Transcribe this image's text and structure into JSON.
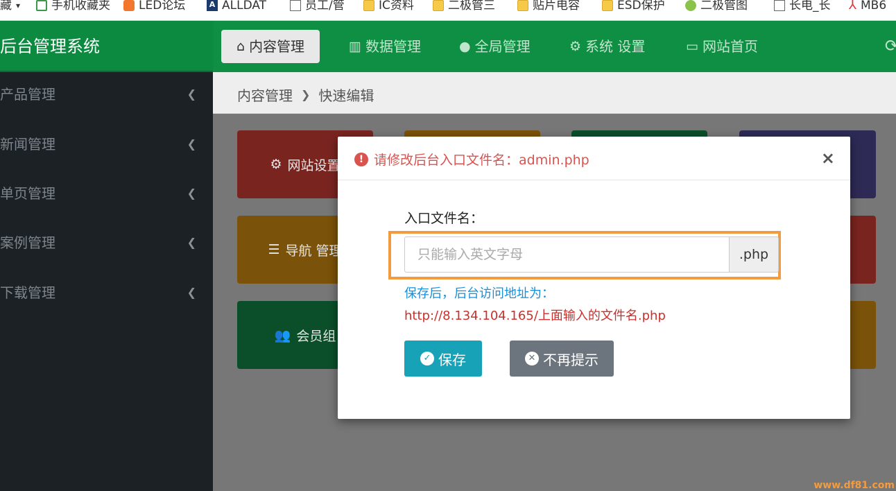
{
  "bookmarks": [
    {
      "label": "藏",
      "icon": "chevron-down-icon"
    },
    {
      "label": "手机收藏夹",
      "icon": "phone-icon"
    },
    {
      "label": "LED论坛",
      "icon": "plug-icon"
    },
    {
      "label": "ALLDAT",
      "icon": "pdf-a-icon"
    },
    {
      "label": "员工/管",
      "icon": "page-icon"
    },
    {
      "label": "IC资料",
      "icon": "folder-icon"
    },
    {
      "label": "二极管三",
      "icon": "folder-icon"
    },
    {
      "label": "贴片电容",
      "icon": "folder-icon"
    },
    {
      "label": "ESD保护",
      "icon": "folder-icon"
    },
    {
      "label": "二极管图",
      "icon": "leaf-icon"
    },
    {
      "label": "长电_长",
      "icon": "page-icon"
    },
    {
      "label": "MB6",
      "icon": "acrobat-icon"
    }
  ],
  "brand": "后台管理系统",
  "nav": [
    {
      "label": "内容管理",
      "icon": "home-icon",
      "active": true
    },
    {
      "label": "数据管理",
      "icon": "bar-chart-icon",
      "active": false
    },
    {
      "label": "全局管理",
      "icon": "globe-icon",
      "active": false
    },
    {
      "label": "系统 设置",
      "icon": "gears-icon",
      "active": false
    },
    {
      "label": "网站首页",
      "icon": "monitor-icon",
      "active": false
    }
  ],
  "sidebar": [
    {
      "label": "产品管理"
    },
    {
      "label": "新闻管理"
    },
    {
      "label": "单页管理"
    },
    {
      "label": "案例管理"
    },
    {
      "label": "下载管理"
    }
  ],
  "breadcrumb": {
    "root": "内容管理",
    "current": "快速编辑"
  },
  "tiles": [
    {
      "label": "网站设置",
      "icon": "gear-icon"
    },
    {
      "label": "导航 管理",
      "icon": "list-icon"
    },
    {
      "label": "会员组",
      "icon": "users-icon"
    }
  ],
  "modal": {
    "title": "请修改后台入口文件名：admin.php",
    "close": "×",
    "field_label": "入口文件名：",
    "placeholder": "只能输入英文字母",
    "value": "",
    "suffix": ".php",
    "note_line1": "保存后，后台访问地址为：",
    "note_line2": "http://8.134.104.165/上面输入的文件名.php",
    "save_label": "保存",
    "skip_label": "不再提示"
  },
  "watermark": "www.df81.com",
  "colors": {
    "header_green": "#0e8f43",
    "sidebar_dark": "#1c2125",
    "danger": "#d9534f",
    "info": "#17a2b8",
    "secondary": "#6c757d",
    "highlight_orange": "#f39c3f"
  }
}
